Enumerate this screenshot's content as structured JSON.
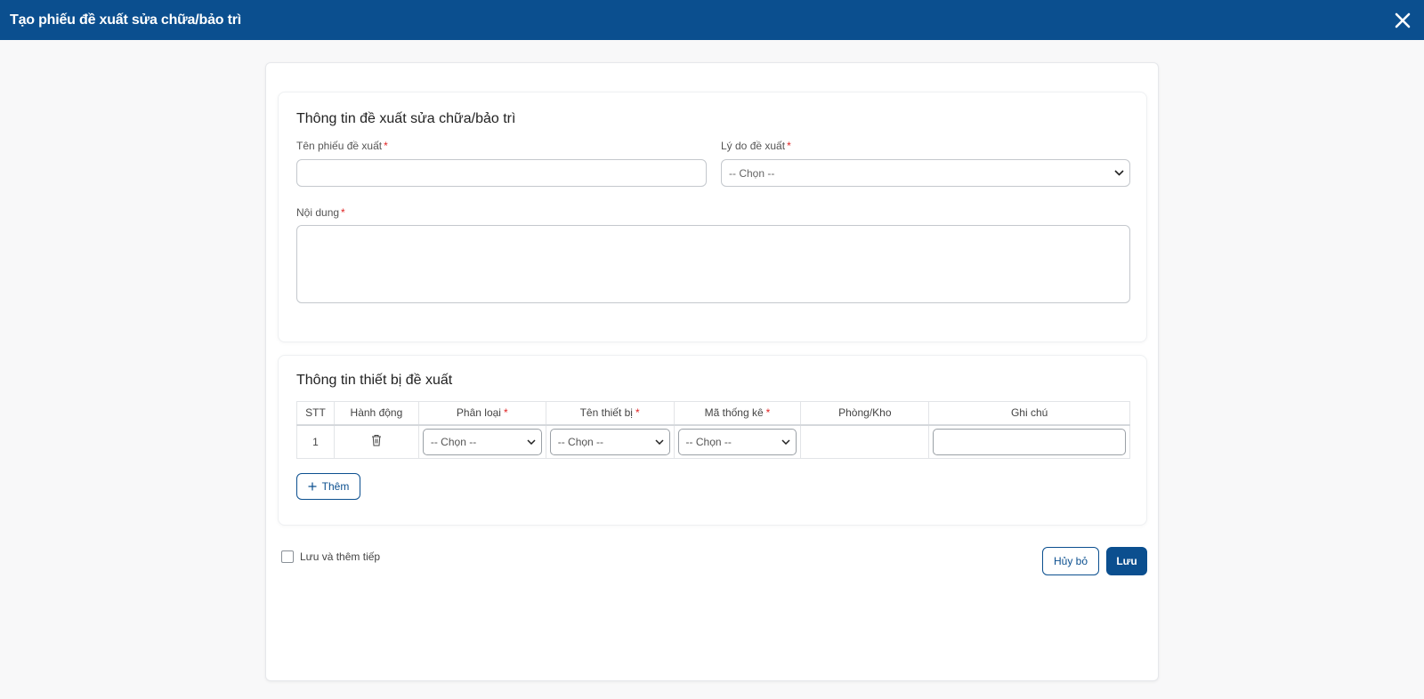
{
  "dialog": {
    "title": "Tạo phiếu đề xuất sửa chữa/bảo trì",
    "close_icon": "close-icon"
  },
  "proposal_info": {
    "heading": "Thông tin đề xuất sửa chữa/bảo trì",
    "name_label": "Tên phiếu đề xuất",
    "name_value": "",
    "reason_label": "Lý do đề xuất",
    "reason_selected": "-- Chọn --",
    "content_label": "Nội dung",
    "content_value": "",
    "required_mark": "*"
  },
  "device_info": {
    "heading": "Thông tin thiết bị đề xuất",
    "columns": {
      "stt": "STT",
      "action": "Hành động",
      "category": "Phân loại",
      "device_name": "Tên thiết bị",
      "stat_code": "Mã thống kê",
      "room": "Phòng/Kho",
      "note": "Ghi chú"
    },
    "required_mark": "*",
    "rows": [
      {
        "stt": "1",
        "action_icon": "trash-icon",
        "category": "-- Chọn --",
        "device_name": "-- Chọn --",
        "stat_code": "-- Chọn --",
        "room": "",
        "note": ""
      }
    ],
    "add_label": "Thêm"
  },
  "footer": {
    "save_continue_label": "Lưu và thêm tiếp",
    "save_continue_checked": false,
    "cancel_label": "Hủy bỏ",
    "save_label": "Lưu"
  },
  "colors": {
    "primary": "#0b4f8f",
    "required": "#e02424",
    "background": "#f8f8f9"
  }
}
